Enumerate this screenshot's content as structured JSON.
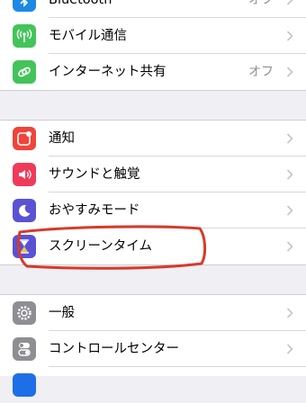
{
  "groups": [
    {
      "rows": [
        {
          "label": "Bluetooth",
          "value": "オフ",
          "icon": "bluetooth-icon",
          "color": "#1e88e5"
        },
        {
          "label": "モバイル通信",
          "icon": "antenna-icon",
          "color": "#43c45a"
        },
        {
          "label": "インターネット共有",
          "value": "オフ",
          "icon": "link-icon",
          "color": "#43c45a"
        }
      ]
    },
    {
      "rows": [
        {
          "label": "通知",
          "icon": "notification-icon",
          "color": "#f0443b"
        },
        {
          "label": "サウンドと触覚",
          "icon": "speaker-icon",
          "color": "#f03a5a"
        },
        {
          "label": "おやすみモード",
          "icon": "moon-icon",
          "color": "#5a52d4"
        },
        {
          "label": "スクリーンタイム",
          "icon": "hourglass-icon",
          "color": "#5a52d4"
        }
      ]
    },
    {
      "rows": [
        {
          "label": "一般",
          "icon": "gear-icon",
          "color": "#8e8e93"
        },
        {
          "label": "コントロールセンター",
          "icon": "toggles-icon",
          "color": "#8e8e93"
        }
      ]
    }
  ],
  "annotation_color": "#d63b2a"
}
